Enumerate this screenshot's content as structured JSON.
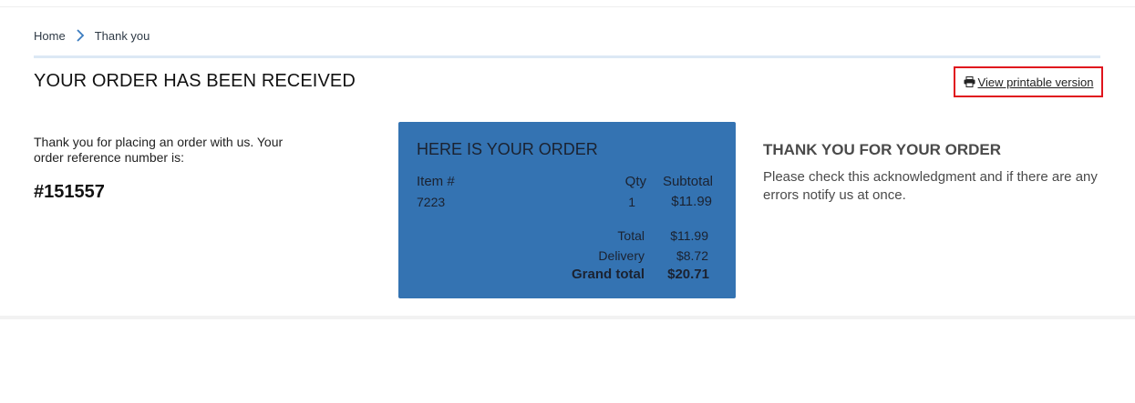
{
  "breadcrumb": {
    "home": "Home",
    "current": "Thank you"
  },
  "page": {
    "title": "YOUR ORDER HAS BEEN RECEIVED",
    "print_link": "View printable version"
  },
  "intro": {
    "text": "Thank you for placing an order with us. Your order reference number is:",
    "order_reference": "#151557"
  },
  "order_summary": {
    "title": "HERE IS YOUR ORDER",
    "headers": {
      "item": "Item #",
      "qty": "Qty",
      "subtotal": "Subtotal"
    },
    "items": [
      {
        "item": "7223",
        "qty": "1",
        "subtotal": "$11.99"
      }
    ],
    "totals": {
      "total_label": "Total",
      "total_value": "$11.99",
      "delivery_label": "Delivery",
      "delivery_value": "$8.72",
      "grand_total_label": "Grand total",
      "grand_total_value": "$20.71"
    },
    "background_color": "#3473b2"
  },
  "thanks": {
    "heading": "THANK YOU FOR YOUR ORDER",
    "text": "Please check this acknowledgment and if there are any errors notify us at once."
  },
  "colors": {
    "highlight_border": "#e0141d",
    "title_rule": "#dce8f5"
  },
  "icons": {
    "breadcrumb_separator": "chevron-right-icon",
    "print": "printer-icon"
  }
}
